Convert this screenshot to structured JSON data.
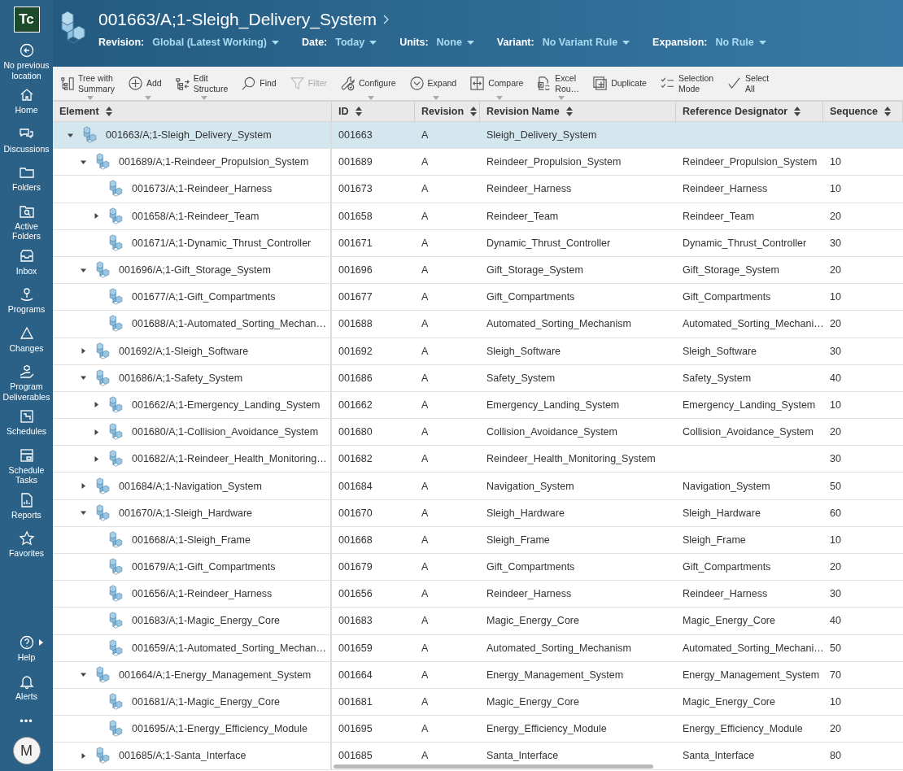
{
  "app_logo": "Tc",
  "sidebar": {
    "items": [
      {
        "label": "No previous\nlocation"
      },
      {
        "label": "Home"
      },
      {
        "label": "Discussions"
      },
      {
        "label": "Folders"
      },
      {
        "label": "Active\nFolders"
      },
      {
        "label": "Inbox"
      },
      {
        "label": "Programs"
      },
      {
        "label": "Changes"
      },
      {
        "label": "Program\nDeliverables"
      },
      {
        "label": "Schedules"
      },
      {
        "label": "Schedule\nTasks"
      },
      {
        "label": "Reports"
      },
      {
        "label": "Favorites"
      }
    ],
    "bottom_items": [
      {
        "label": "Help"
      },
      {
        "label": "Alerts"
      }
    ],
    "more": "•••",
    "avatar": "M"
  },
  "header": {
    "title": "001663/A;1-Sleigh_Delivery_System",
    "filters": [
      {
        "label": "Revision:",
        "value": "Global (Latest Working)"
      },
      {
        "label": "Date:",
        "value": "Today"
      },
      {
        "label": "Units:",
        "value": "None"
      },
      {
        "label": "Variant:",
        "value": "No Variant Rule"
      },
      {
        "label": "Expansion:",
        "value": "No Rule"
      }
    ]
  },
  "toolbar": [
    {
      "label": "Tree with\nSummary",
      "has_menu": true,
      "disabled": false
    },
    {
      "label": "Add",
      "has_menu": true,
      "disabled": false
    },
    {
      "label": "Edit\nStructure",
      "has_menu": true,
      "disabled": false
    },
    {
      "label": "Find",
      "has_menu": false,
      "disabled": false
    },
    {
      "label": "Filter",
      "has_menu": false,
      "disabled": true
    },
    {
      "label": "Configure",
      "has_menu": true,
      "disabled": false
    },
    {
      "label": "Expand",
      "has_menu": true,
      "disabled": false
    },
    {
      "label": "Compare",
      "has_menu": true,
      "disabled": false
    },
    {
      "label": "Excel\nRou…",
      "has_menu": true,
      "disabled": false
    },
    {
      "label": "Duplicate",
      "has_menu": false,
      "disabled": false
    },
    {
      "label": "Selection\nMode",
      "has_menu": false,
      "disabled": false
    },
    {
      "label": "Select\nAll",
      "has_menu": false,
      "disabled": false
    }
  ],
  "table": {
    "columns": [
      "Element",
      "ID",
      "Revision",
      "Revision Name",
      "Reference Designator",
      "Sequence"
    ],
    "rows": [
      {
        "element": "001663/A;1-Sleigh_Delivery_System",
        "id": "001663",
        "revision": "A",
        "revision_name": "Sleigh_Delivery_System",
        "selected": true,
        "expanded": true,
        "children": [
          {
            "element": "001689/A;1-Reindeer_Propulsion_System",
            "id": "001689",
            "revision": "A",
            "revision_name": "Reindeer_Propulsion_System",
            "reference_designator": "Reindeer_Propulsion_System",
            "sequence": "10",
            "selected": false,
            "expanded": true,
            "children": [
              {
                "element": "001673/A;1-Reindeer_Harness",
                "id": "001673",
                "revision": "A",
                "revision_name": "Reindeer_Harness",
                "reference_designator": "Reindeer_Harness",
                "sequence": "10",
                "selected": false
              },
              {
                "element": "001658/A;1-Reindeer_Team",
                "id": "001658",
                "revision": "A",
                "revision_name": "Reindeer_Team",
                "reference_designator": "Reindeer_Team",
                "sequence": "20",
                "selected": false,
                "expanded": false
              },
              {
                "element": "001671/A;1-Dynamic_Thrust_Controller",
                "id": "001671",
                "revision": "A",
                "revision_name": "Dynamic_Thrust_Controller",
                "reference_designator": "Dynamic_Thrust_Controller",
                "sequence": "30",
                "selected": false
              }
            ]
          },
          {
            "element": "001696/A;1-Gift_Storage_System",
            "id": "001696",
            "revision": "A",
            "revision_name": "Gift_Storage_System",
            "reference_designator": "Gift_Storage_System",
            "sequence": "20",
            "selected": false,
            "expanded": true,
            "children": [
              {
                "element": "001677/A;1-Gift_Compartments",
                "id": "001677",
                "revision": "A",
                "revision_name": "Gift_Compartments",
                "reference_designator": "Gift_Compartments",
                "sequence": "10",
                "selected": false
              },
              {
                "element": "001688/A;1-Automated_Sorting_Mechan…",
                "id": "001688",
                "revision": "A",
                "revision_name": "Automated_Sorting_Mechanism",
                "reference_designator": "Automated_Sorting_Mechani…",
                "sequence": "20",
                "selected": false
              }
            ]
          },
          {
            "element": "001692/A;1-Sleigh_Software",
            "id": "001692",
            "revision": "A",
            "revision_name": "Sleigh_Software",
            "reference_designator": "Sleigh_Software",
            "sequence": "30",
            "selected": false,
            "expanded": false
          },
          {
            "element": "001686/A;1-Safety_System",
            "id": "001686",
            "revision": "A",
            "revision_name": "Safety_System",
            "reference_designator": "Safety_System",
            "sequence": "40",
            "selected": false,
            "expanded": true,
            "children": [
              {
                "element": "001662/A;1-Emergency_Landing_System",
                "id": "001662",
                "revision": "A",
                "revision_name": "Emergency_Landing_System",
                "reference_designator": "Emergency_Landing_System",
                "sequence": "10",
                "selected": false,
                "expanded": false
              },
              {
                "element": "001680/A;1-Collision_Avoidance_System",
                "id": "001680",
                "revision": "A",
                "revision_name": "Collision_Avoidance_System",
                "reference_designator": "Collision_Avoidance_System",
                "sequence": "20",
                "selected": false,
                "expanded": false
              },
              {
                "element": "001682/A;1-Reindeer_Health_Monitoring…",
                "id": "001682",
                "revision": "A",
                "revision_name": "Reindeer_Health_Monitoring_System",
                "sequence": "30",
                "selected": false,
                "expanded": false
              }
            ]
          },
          {
            "element": "001684/A;1-Navigation_System",
            "id": "001684",
            "revision": "A",
            "revision_name": "Navigation_System",
            "reference_designator": "Navigation_System",
            "sequence": "50",
            "selected": false,
            "expanded": false
          },
          {
            "element": "001670/A;1-Sleigh_Hardware",
            "id": "001670",
            "revision": "A",
            "revision_name": "Sleigh_Hardware",
            "reference_designator": "Sleigh_Hardware",
            "sequence": "60",
            "selected": false,
            "expanded": true,
            "children": [
              {
                "element": "001668/A;1-Sleigh_Frame",
                "id": "001668",
                "revision": "A",
                "revision_name": "Sleigh_Frame",
                "reference_designator": "Sleigh_Frame",
                "sequence": "10",
                "selected": false
              },
              {
                "element": "001679/A;1-Gift_Compartments",
                "id": "001679",
                "revision": "A",
                "revision_name": "Gift_Compartments",
                "reference_designator": "Gift_Compartments",
                "sequence": "20",
                "selected": false
              },
              {
                "element": "001656/A;1-Reindeer_Harness",
                "id": "001656",
                "revision": "A",
                "revision_name": "Reindeer_Harness",
                "reference_designator": "Reindeer_Harness",
                "sequence": "30",
                "selected": false
              },
              {
                "element": "001683/A;1-Magic_Energy_Core",
                "id": "001683",
                "revision": "A",
                "revision_name": "Magic_Energy_Core",
                "reference_designator": "Magic_Energy_Core",
                "sequence": "40",
                "selected": false
              },
              {
                "element": "001659/A;1-Automated_Sorting_Mechan…",
                "id": "001659",
                "revision": "A",
                "revision_name": "Automated_Sorting_Mechanism",
                "reference_designator": "Automated_Sorting_Mechani…",
                "sequence": "50",
                "selected": false
              }
            ]
          },
          {
            "element": "001664/A;1-Energy_Management_System",
            "id": "001664",
            "revision": "A",
            "revision_name": "Energy_Management_System",
            "reference_designator": "Energy_Management_System",
            "sequence": "70",
            "selected": false,
            "expanded": true,
            "children": [
              {
                "element": "001681/A;1-Magic_Energy_Core",
                "id": "001681",
                "revision": "A",
                "revision_name": "Magic_Energy_Core",
                "reference_designator": "Magic_Energy_Core",
                "sequence": "10",
                "selected": false
              },
              {
                "element": "001695/A;1-Energy_Efficiency_Module",
                "id": "001695",
                "revision": "A",
                "revision_name": "Energy_Efficiency_Module",
                "reference_designator": "Energy_Efficiency_Module",
                "sequence": "20",
                "selected": false
              }
            ]
          },
          {
            "element": "001685/A;1-Santa_Interface",
            "id": "001685",
            "revision": "A",
            "revision_name": "Santa_Interface",
            "reference_designator": "Santa_Interface",
            "sequence": "80",
            "selected": false,
            "expanded": false
          }
        ]
      }
    ]
  }
}
